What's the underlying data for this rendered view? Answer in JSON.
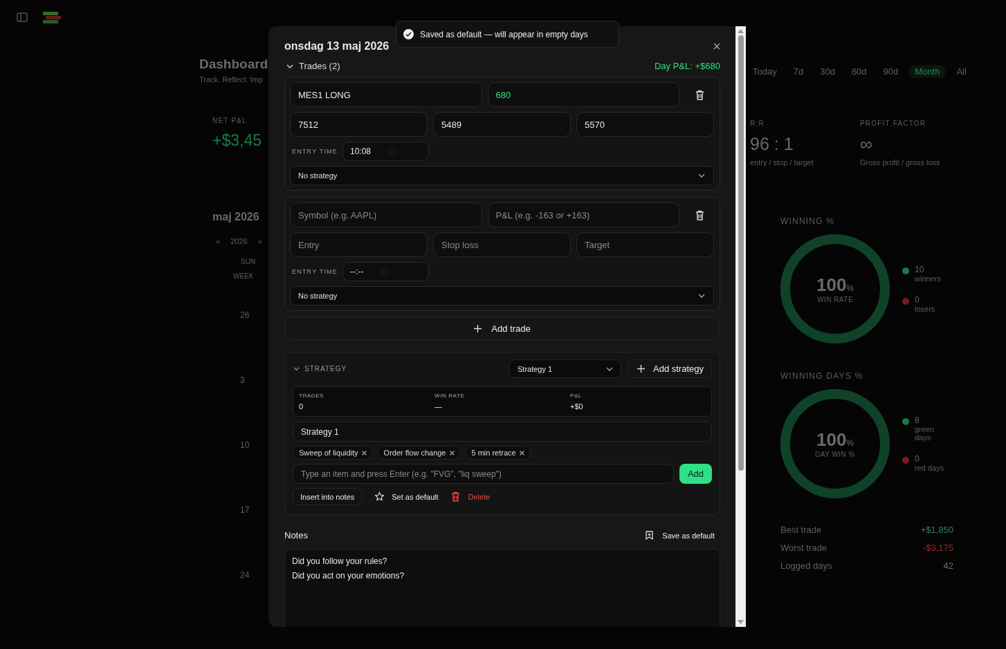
{
  "dashboard": {
    "title": "Dashboard",
    "subtitle": "Track. Reflect. Imp",
    "net_pnl": {
      "label": "NET P&L",
      "value": "+$3,45"
    },
    "calendar": {
      "month": "maj 2026",
      "prev": "«",
      "year": "2026",
      "next": "»",
      "weekday": "SUN",
      "week_label": "WEEK",
      "days": [
        "26",
        "3",
        "10",
        "17",
        "24"
      ]
    }
  },
  "range_tabs": [
    {
      "label": "Today",
      "selected": false
    },
    {
      "label": "7d",
      "selected": false
    },
    {
      "label": "30d",
      "selected": false
    },
    {
      "label": "60d",
      "selected": false
    },
    {
      "label": "90d",
      "selected": false
    },
    {
      "label": "Month",
      "selected": true
    },
    {
      "label": "All",
      "selected": false
    }
  ],
  "stats": [
    {
      "label": "R:R",
      "value": "96 : 1",
      "caption": "entry / stop / target"
    },
    {
      "label": "PROFIT FACTOR",
      "value": "∞",
      "caption": "Gross profit / gross loss"
    }
  ],
  "rings": [
    {
      "title": "WINNING  %",
      "percent": "100",
      "unit": "%",
      "caption": "WIN RATE",
      "level": 1,
      "legend": [
        {
          "count": "10",
          "label": "winners",
          "color": "#1a7a46"
        },
        {
          "count": "0",
          "label": "losers",
          "color": "#7a1a1a"
        }
      ]
    },
    {
      "title": "WINNING  DAYS  %",
      "percent": "100",
      "unit": "%",
      "caption": "DAY WIN %",
      "level": 1,
      "legend": [
        {
          "count": "8",
          "label": "green days",
          "color": "#1a7a46"
        },
        {
          "count": "0",
          "label": "red days",
          "color": "#7a1a1a"
        }
      ]
    }
  ],
  "summary": [
    {
      "label": "Best trade",
      "value": "+$1,850",
      "color": "#1f8a50"
    },
    {
      "label": "Worst trade",
      "value": "-$3,175",
      "color": "#9a2a2a"
    },
    {
      "label": "Logged days",
      "value": "42",
      "color": "#707070"
    }
  ],
  "toast": {
    "text": "Saved as default — will appear in empty days"
  },
  "modal": {
    "title": "onsdag 13 maj 2026",
    "trades_header": {
      "label": "Trades (2)",
      "expanded": true
    },
    "day_pnl": "Day P&L: +$680",
    "trades": [
      {
        "symbol": {
          "value": "MES1 LONG"
        },
        "pnl": {
          "value": "680"
        },
        "entry": {
          "value": "7512"
        },
        "stop": {
          "value": "5489"
        },
        "target": {
          "value": "5570"
        },
        "entry_time_label": "ENTRY TIME",
        "entry_time": "10:08",
        "strategy": "No strategy"
      },
      {
        "symbol": {
          "placeholder": "Symbol (e.g. AAPL)"
        },
        "pnl": {
          "placeholder": "P&L (e.g. -163 or +163)"
        },
        "entry": {
          "placeholder": "Entry"
        },
        "stop": {
          "placeholder": "Stop loss"
        },
        "target": {
          "placeholder": "Target"
        },
        "entry_time_label": "ENTRY TIME",
        "entry_time": "--:--",
        "strategy": "No strategy"
      }
    ],
    "add_trade": "Add trade",
    "strategy": {
      "label": "STRATEGY",
      "expanded": true,
      "selected": "Strategy 1",
      "add_button": "Add strategy",
      "stats": [
        {
          "label": "TRADES",
          "value": "0"
        },
        {
          "label": "WIN RATE",
          "value": "—"
        },
        {
          "label": "P&L",
          "value": "+$0"
        }
      ],
      "name": "Strategy 1",
      "tags": [
        "Sweep of liquidity",
        "Order flow change",
        "5 min retrace"
      ],
      "item_placeholder": "Type an item and press Enter (e.g. \"FVG\", \"liq sweep\")",
      "add": "Add",
      "insert": "Insert into notes",
      "set_default": "Set as default",
      "delete": "Delete"
    },
    "notes": {
      "label": "Notes",
      "save_default": "Save as default",
      "text": "Did you follow your rules?\nDid you act on your emotions?"
    }
  }
}
